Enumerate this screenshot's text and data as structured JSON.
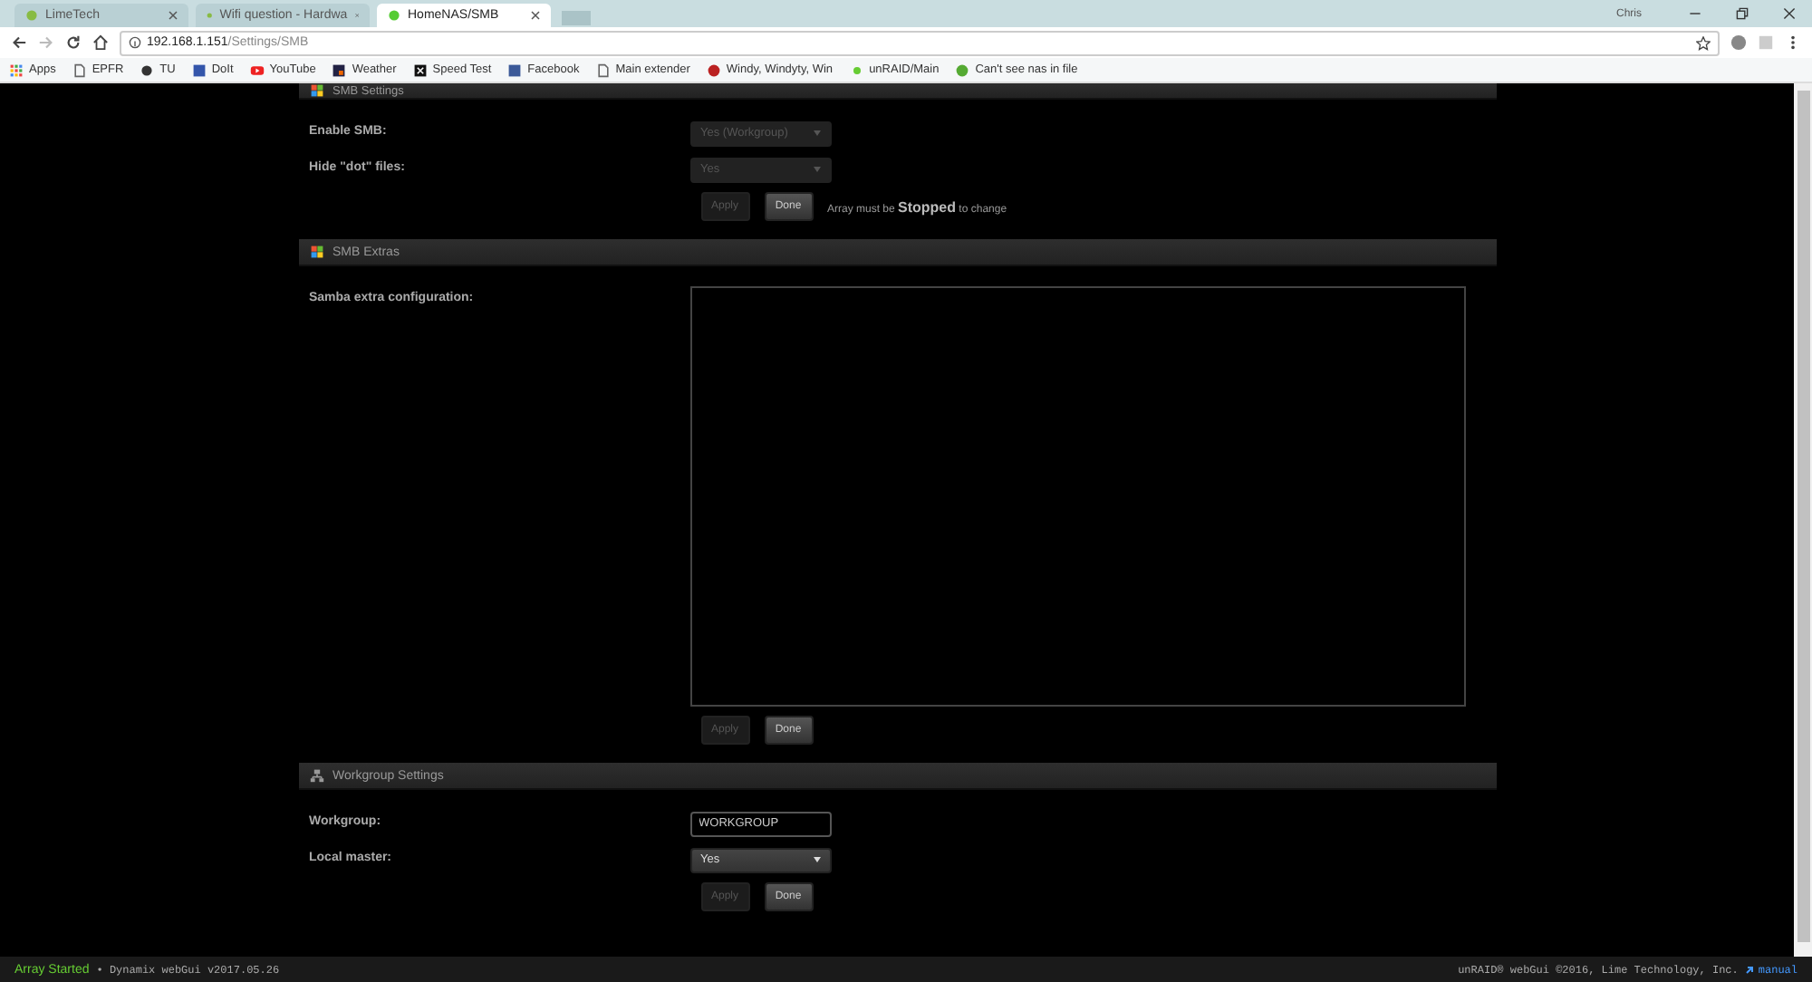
{
  "browser": {
    "tabs": [
      {
        "title": "LimeTech",
        "selected": false
      },
      {
        "title": "Wifi question - Hardwa",
        "selected": false
      },
      {
        "title": "HomeNAS/SMB",
        "selected": true
      }
    ],
    "profile": "Chris",
    "url": {
      "host": "192.168.1.151",
      "path": "/Settings/SMB"
    },
    "bookmarks": [
      {
        "label": "Apps"
      },
      {
        "label": "EPFR"
      },
      {
        "label": "TU"
      },
      {
        "label": "DoIt"
      },
      {
        "label": "YouTube"
      },
      {
        "label": "Weather"
      },
      {
        "label": "Speed Test"
      },
      {
        "label": "Facebook"
      },
      {
        "label": "Main extender"
      },
      {
        "label": "Windy, Windyty, Win"
      },
      {
        "label": "unRAID/Main"
      },
      {
        "label": "Can't see nas in file"
      }
    ]
  },
  "sections": [
    {
      "title": "SMB Settings",
      "rows": [
        {
          "label": "Enable SMB:",
          "kind": "select",
          "value": "Yes (Workgroup)",
          "disabled": true
        },
        {
          "label": "Hide \"dot\" files:",
          "kind": "select",
          "value": "Yes",
          "disabled": true
        }
      ],
      "buttons": [
        {
          "label": "Apply",
          "disabled": true
        },
        {
          "label": "Done",
          "disabled": false
        }
      ],
      "note": "Array must be **Stopped** to change"
    },
    {
      "title": "SMB Extras",
      "rows": [
        {
          "label": "Samba extra configuration:",
          "kind": "textarea"
        }
      ],
      "buttons": [
        {
          "label": "Apply",
          "disabled": true
        },
        {
          "label": "Done",
          "disabled": false
        }
      ]
    },
    {
      "title": "Workgroup Settings",
      "rows": [
        {
          "label": "Workgroup:",
          "kind": "input",
          "value": "WORKGROUP"
        },
        {
          "label": "Local master:",
          "kind": "select",
          "value": "Yes",
          "disabled": false
        }
      ],
      "buttons": [
        {
          "label": "Apply",
          "disabled": true
        },
        {
          "label": "Done",
          "disabled": false
        }
      ]
    }
  ],
  "footer": {
    "status": "Array Started",
    "version": "• Dynamix webGui v2017.05.26",
    "copyright": "unRAID® webGui ©2016, Lime Technology, Inc.",
    "link": "manual"
  }
}
